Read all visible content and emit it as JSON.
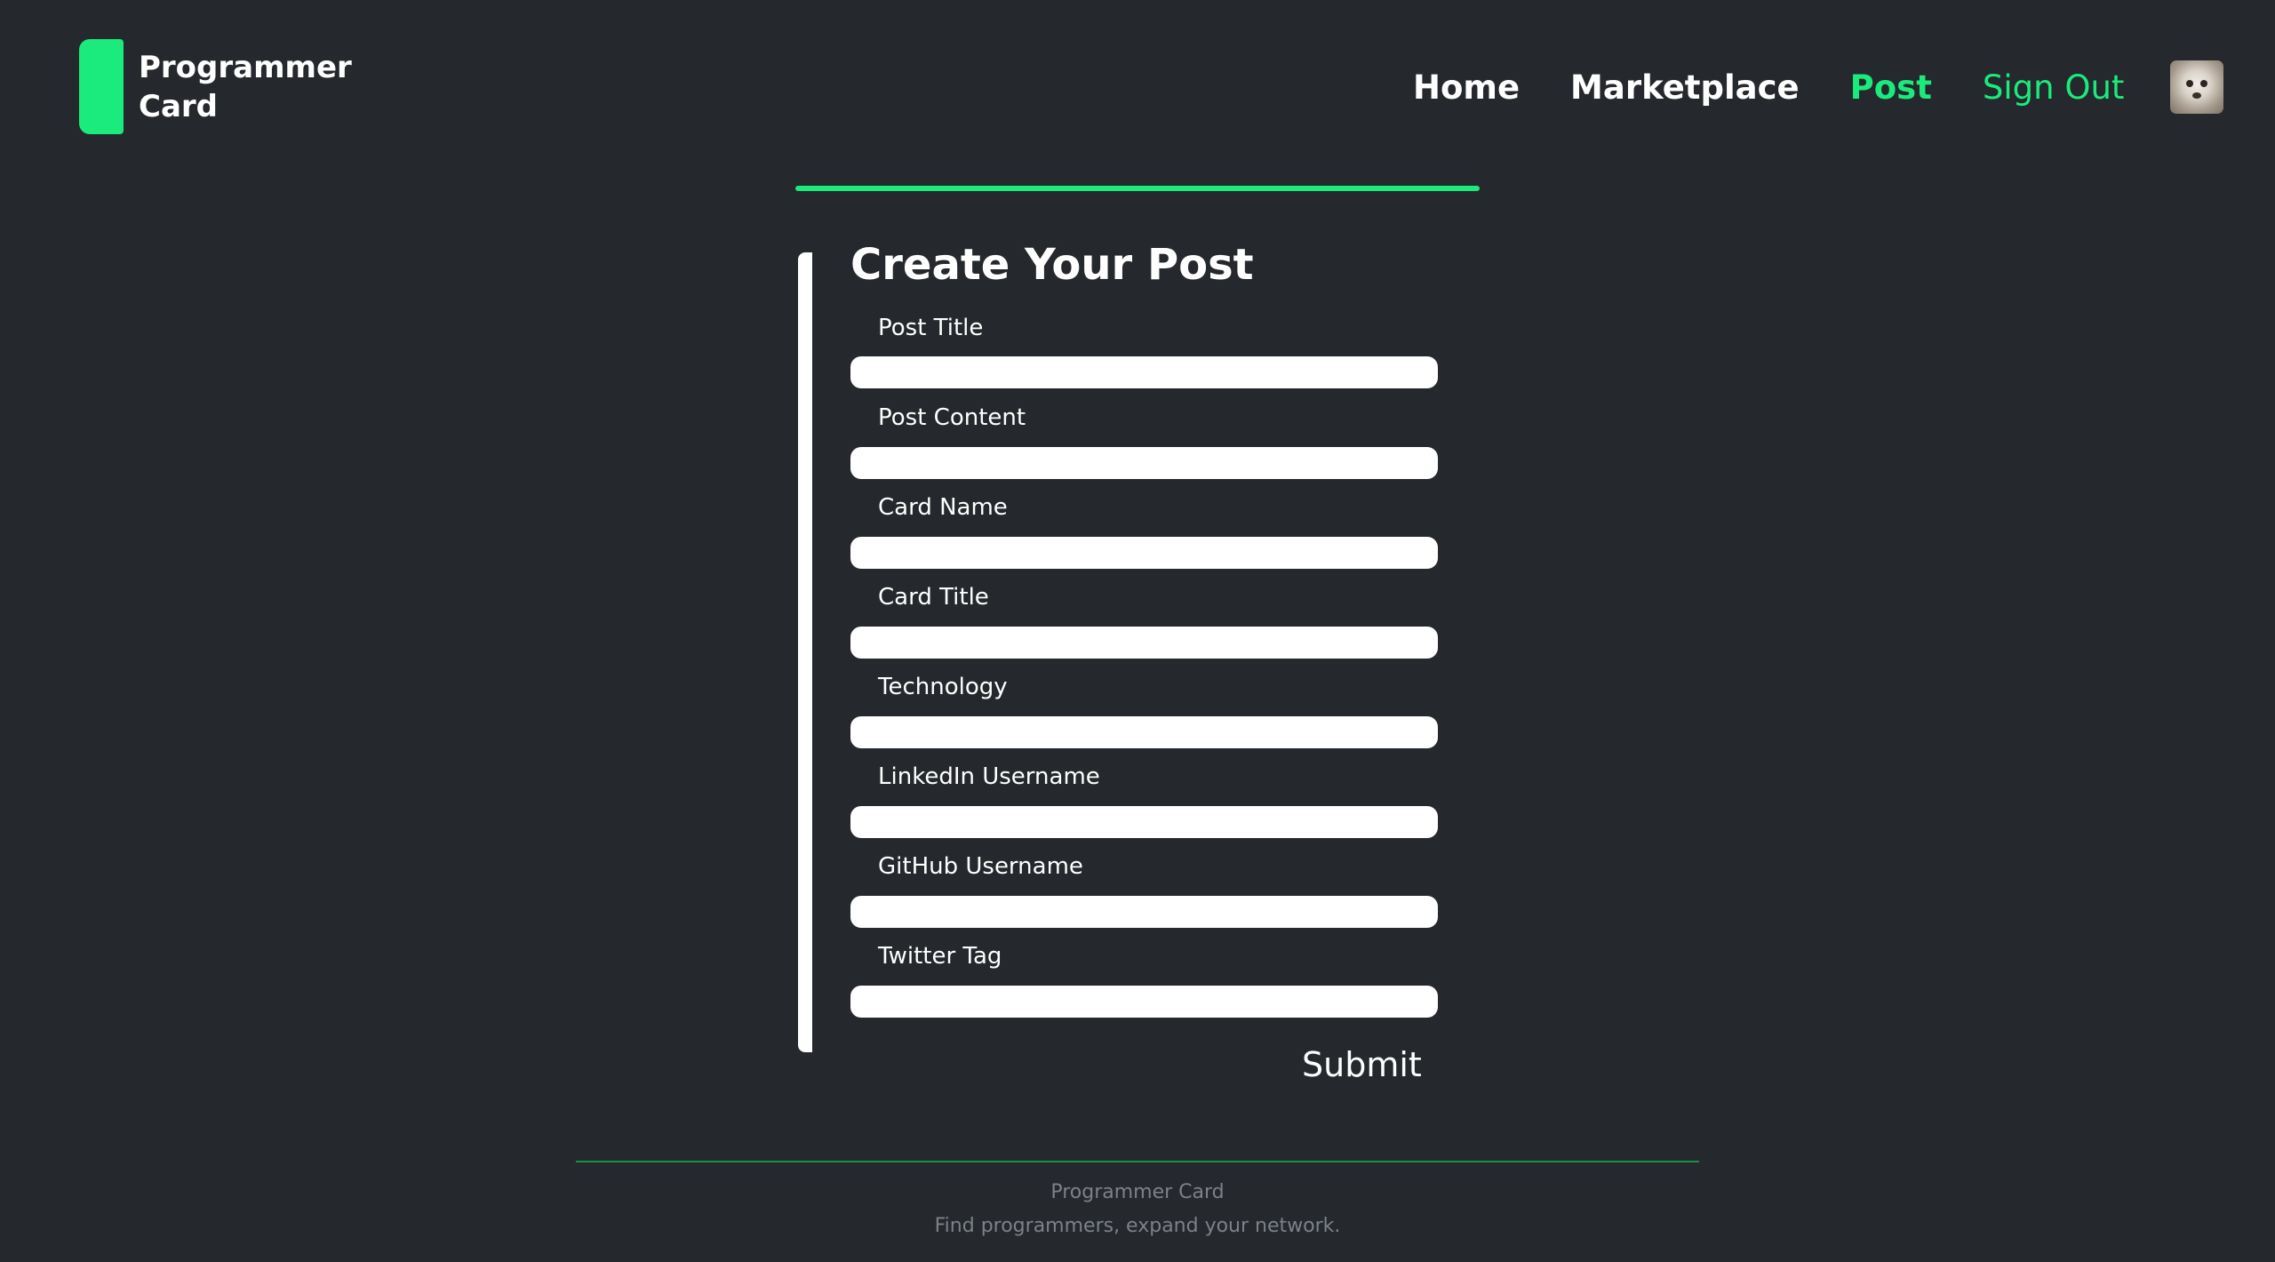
{
  "brand": {
    "name_line1": "Programmer",
    "name_line2": "Card",
    "accent_color": "#1aeb7c",
    "background_color": "#25282c"
  },
  "nav": {
    "home": "Home",
    "marketplace": "Marketplace",
    "post": "Post",
    "sign_out": "Sign Out",
    "active_item": "Post",
    "avatar_icon": "user-avatar-photo"
  },
  "form": {
    "title": "Create Your Post",
    "fields": [
      {
        "label": "Post Title",
        "value": ""
      },
      {
        "label": "Post Content",
        "value": ""
      },
      {
        "label": "Card Name",
        "value": ""
      },
      {
        "label": "Card Title",
        "value": ""
      },
      {
        "label": "Technology",
        "value": ""
      },
      {
        "label": "LinkedIn Username",
        "value": ""
      },
      {
        "label": "GitHub Username",
        "value": ""
      },
      {
        "label": "Twitter Tag",
        "value": ""
      }
    ],
    "submit_label": "Submit"
  },
  "footer": {
    "name": "Programmer Card",
    "tagline": "Find programmers, expand your network."
  }
}
